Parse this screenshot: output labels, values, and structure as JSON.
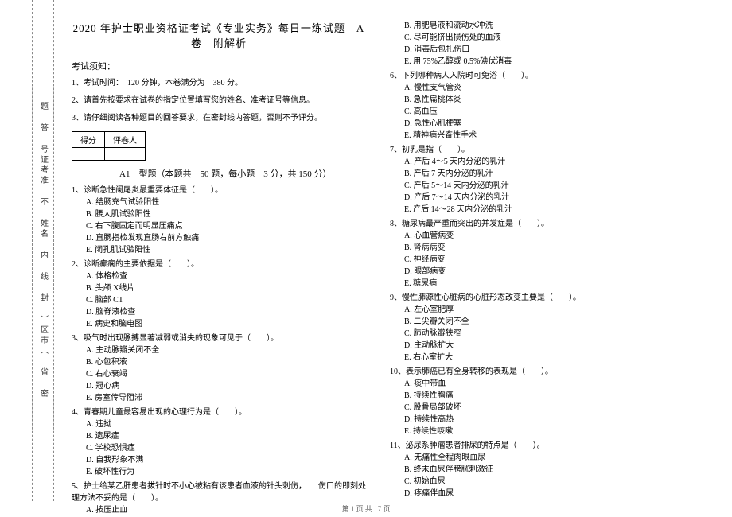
{
  "binding_text": "题 答 号证考准 不 姓名 内 线 封 ）区市（ 省 密",
  "seal_text": "",
  "title": "2020 年护士职业资格证考试《专业实务》每日一练试题　A 卷　附解析",
  "notice_header": "考试须知：",
  "notices": [
    "1、考试时间：　120 分钟，本卷满分为　380 分。",
    "2、请首先按要求在试卷的指定位置填写您的姓名、准考证号等信息。",
    "3、请仔细阅读各种题目的回答要求，在密封线内答题，否则不予评分。"
  ],
  "score_cells": [
    "得分",
    "评卷人"
  ],
  "section_title": "A1　型题（本题共　50 题，每小题　3 分，共 150 分）",
  "left_questions": [
    {
      "q": "1、诊断急性阑尾炎最重要体征是（　　）。",
      "opts": [
        "A. 结肠充气试验阳性",
        "B. 腰大肌试验阳性",
        "C. 右下腹固定而明显压痛点",
        "D. 直肠指检发现直肠右前方触痛",
        "E. 闭孔肌试验阳性"
      ]
    },
    {
      "q": "2、诊断癫痫的主要依据是（　　）。",
      "opts": [
        "A. 体格检查",
        "B. 头颅 X线片",
        "C. 脑部 CT",
        "D. 脑脊液检查",
        "E. 病史和脑电图"
      ]
    },
    {
      "q": "3、吸气时出现脉搏显著减弱或消失的现象可见于（　　）。",
      "opts": [
        "A. 主动脉瓣关闭不全",
        "B. 心包积液",
        "C. 右心衰竭",
        "D. 冠心病",
        "E. 房室传导阻滞"
      ]
    },
    {
      "q": "4、青春期儿童最容易出现的心理行为是（　　）。",
      "opts": [
        "A. 违拗",
        "B. 遗尿症",
        "C. 学校恐惧症",
        "D. 自我形象不满",
        "E. 破坏性行为"
      ]
    },
    {
      "q": "5、护士给某乙肝患者拔针时不小心被粘有该患者血液的针头刺伤，　　伤口的即刻处理方法不妥的是（　　）。",
      "opts": [
        "A. 按压止血"
      ]
    }
  ],
  "right_continuation": [
    "B. 用肥皂液和流动水冲洗",
    "C. 尽可能挤出损伤处的血液",
    "D. 消毒后包扎伤口",
    "E. 用 75%乙醇或 0.5%碘伏消毒"
  ],
  "right_questions": [
    {
      "q": "6、下列哪种病人入院时可免浴（　　）。",
      "opts": [
        "A. 慢性支气管炎",
        "B. 急性扁桃体炎",
        "C. 高血压",
        "D. 急性心肌梗塞",
        "E. 精神病兴奋性手术"
      ]
    },
    {
      "q": "7、初乳是指（　　）。",
      "opts": [
        "A. 产后 4～5 天内分泌的乳汁",
        "B. 产后 7 天内分泌的乳汁",
        "C. 产后 5～14 天内分泌的乳汁",
        "D. 产后 7～14 天内分泌的乳汁",
        "E. 产后 14～28 天内分泌的乳汁"
      ]
    },
    {
      "q": "8、糖尿病最严重而突出的并发症是（　　）。",
      "opts": [
        "A. 心血管病变",
        "B. 肾病病变",
        "C. 神经病变",
        "D. 眼部病变",
        "E. 糖尿病"
      ]
    },
    {
      "q": "9、慢性肺源性心脏病的心脏形态改变主要是（　　）。",
      "opts": [
        "A. 左心室肥厚",
        "B. 二尖瓣关闭不全",
        "C. 肺动脉瓣狭窄",
        "D. 主动脉扩大",
        "E. 右心室扩大"
      ]
    },
    {
      "q": "10、表示肺癌已有全身转移的表现是（　　）。",
      "opts": [
        "A. 痰中带血",
        "B. 持续性胸痛",
        "C. 股骨局部破坏",
        "D. 持续性高热",
        "E. 持续性咳嗽"
      ]
    },
    {
      "q": "11、泌尿系肿瘤患者排尿的特点是（　　）。",
      "opts": [
        "A. 无痛性全程肉眼血尿",
        "B. 终末血尿伴膀胱刺激征",
        "C. 初始血尿",
        "D. 疼痛伴血尿"
      ]
    }
  ],
  "footer": "第 1 页 共 17 页"
}
